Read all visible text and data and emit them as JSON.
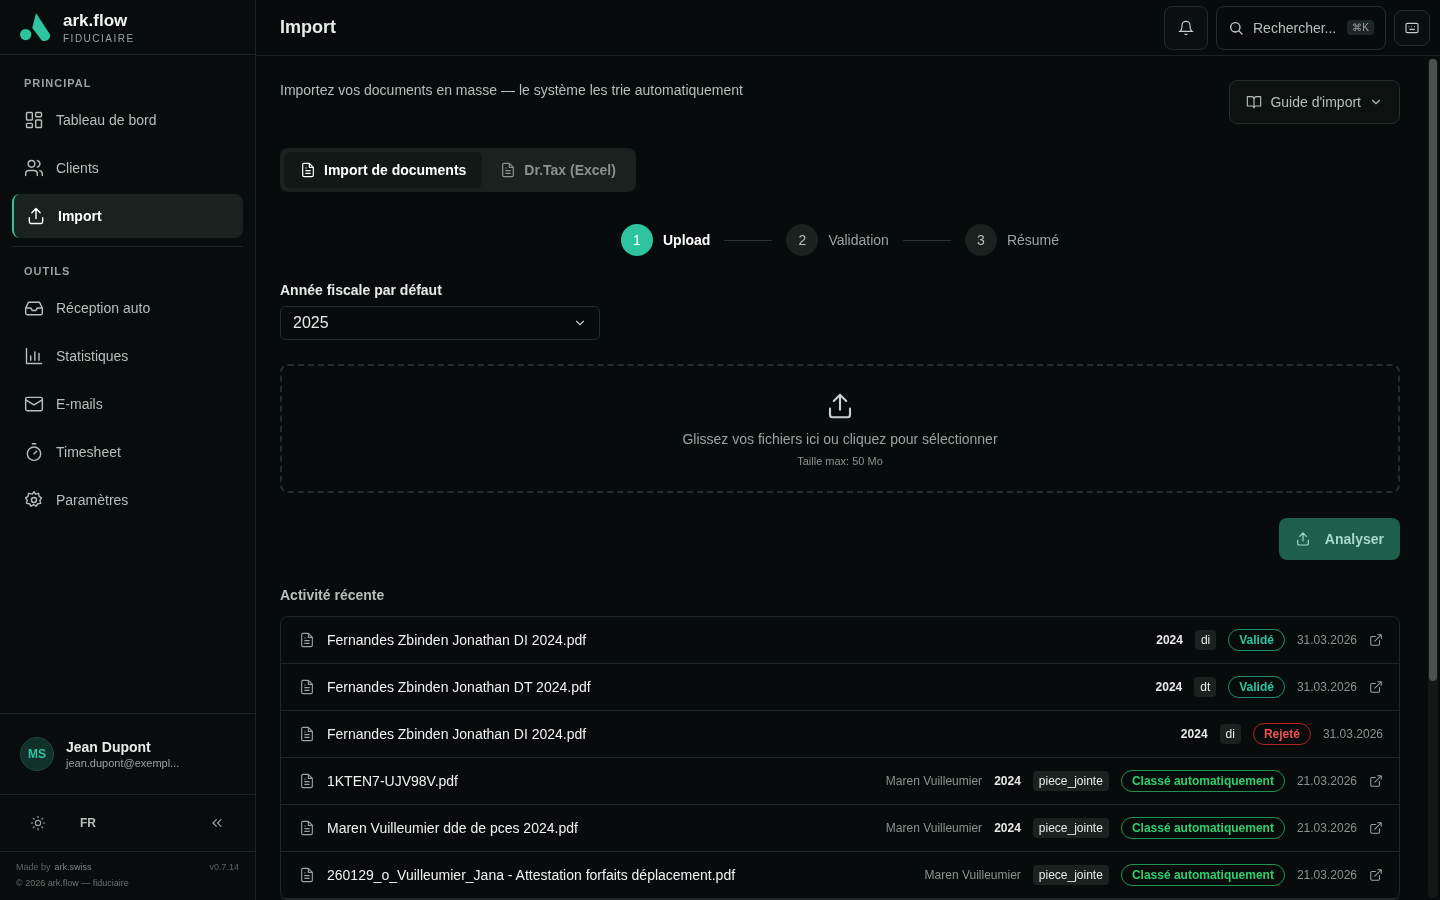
{
  "brand": {
    "name": "ark.flow",
    "subtitle": "FIDUCIAIRE"
  },
  "sidebar": {
    "sections": [
      {
        "title": "PRINCIPAL",
        "items": [
          {
            "label": "Tableau de bord",
            "selected": false
          },
          {
            "label": "Clients",
            "selected": false
          },
          {
            "label": "Import",
            "selected": true
          }
        ]
      },
      {
        "title": "OUTILS",
        "items": [
          {
            "label": "Réception auto",
            "selected": false
          },
          {
            "label": "Statistiques",
            "selected": false
          },
          {
            "label": "E-mails",
            "selected": false
          },
          {
            "label": "Timesheet",
            "selected": false
          },
          {
            "label": "Paramètres",
            "selected": false
          }
        ]
      }
    ],
    "user": {
      "initials": "MS",
      "name": "Jean Dupont",
      "email": "jean.dupont@exempl..."
    },
    "language": "FR",
    "footer": {
      "made_by": "Made by",
      "made_by_link": "ark.swiss",
      "version": "v0.7.14",
      "copyright": "© 2026 ark.flow — fiduciaire"
    }
  },
  "header": {
    "title": "Import",
    "search": {
      "placeholder": "Rechercher...",
      "shortcut": "⌘K"
    }
  },
  "intro": "Importez vos documents en masse — le système les trie automatiquement",
  "guide_button": "Guide d'import",
  "tabs": [
    {
      "label": "Import de documents",
      "selected": true
    },
    {
      "label": "Dr.Tax (Excel)",
      "selected": false
    }
  ],
  "steps": [
    {
      "number": "1",
      "label": "Upload",
      "selected": true
    },
    {
      "number": "2",
      "label": "Validation",
      "selected": false
    },
    {
      "number": "3",
      "label": "Résumé",
      "selected": false
    }
  ],
  "fiscal_year": {
    "label": "Année fiscale par défaut",
    "value": "2025"
  },
  "dropzone": {
    "text": "Glissez vos fichiers ici ou cliquez pour sélectionner",
    "hint": "Taille max: 50 Mo"
  },
  "analyze_button": "Analyser",
  "recent": {
    "title": "Activité récente",
    "rows": [
      {
        "name": "Fernandes Zbinden Jonathan DI 2024.pdf",
        "year": "2024",
        "type": "di",
        "status": "Validé",
        "kind": "validated",
        "date": "31.03.2026",
        "has_link": true
      },
      {
        "name": "Fernandes Zbinden Jonathan DT 2024.pdf",
        "year": "2024",
        "type": "dt",
        "status": "Validé",
        "kind": "validated",
        "date": "31.03.2026",
        "has_link": true
      },
      {
        "name": "Fernandes Zbinden Jonathan DI 2024.pdf",
        "year": "2024",
        "type": "di",
        "status": "Rejeté",
        "kind": "rejected",
        "date": "31.03.2026",
        "has_link": false
      },
      {
        "name": "1KTEN7-UJV98V.pdf",
        "owner": "Maren Vuilleumier",
        "year": "2024",
        "type": "piece_jointe",
        "status": "Classé automatiquement",
        "kind": "auto",
        "date": "21.03.2026",
        "has_link": true
      },
      {
        "name": "Maren Vuilleumier dde de pces 2024.pdf",
        "owner": "Maren Vuilleumier",
        "year": "2024",
        "type": "piece_jointe",
        "status": "Classé automatiquement",
        "kind": "auto",
        "date": "21.03.2026",
        "has_link": true
      },
      {
        "name": "260129_o_Vuilleumier_Jana - Attestation forfaits déplacement.pdf",
        "owner": "Maren Vuilleumier",
        "type": "piece_jointe",
        "status": "Classé automatiquement",
        "kind": "auto",
        "date": "21.03.2026",
        "has_link": true
      }
    ]
  }
}
